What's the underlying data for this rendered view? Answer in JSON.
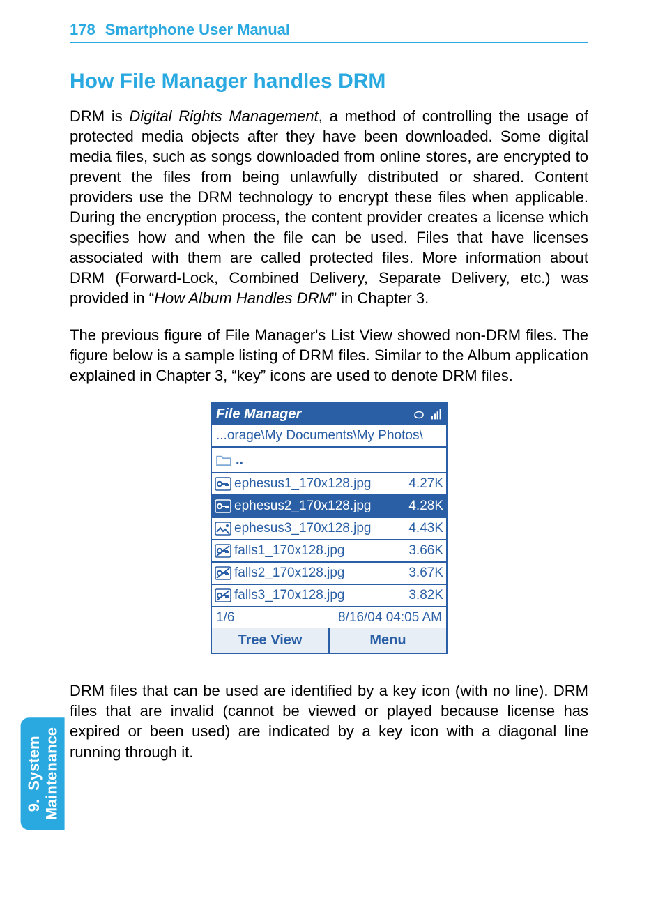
{
  "header": {
    "page_number": "178",
    "title": "Smartphone User Manual"
  },
  "section_heading": "How File Manager handles DRM",
  "para1_pre": "DRM is ",
  "para1_em": "Digital Rights Management",
  "para1_post": ", a method of controlling the usage of protected media objects after they have been downloaded. Some digital media files, such as songs downloaded from online stores, are encrypted to prevent the files from being unlawfully distributed or shared.  Content providers use the DRM technology to encrypt these files when applicable.  During the encryption process, the content provider creates a license which specifies how and when the file can be used.  Files that have licenses associated with them are called protected files.  More information about DRM (Forward-Lock, Combined Delivery, Separate Delivery, etc.) was provided in “",
  "para1_em2": "How Album Handles DRM",
  "para1_tail": "” in Chapter 3.",
  "para2": "The previous figure of File Manager's List View showed non-DRM files.  The figure below is a sample listing of DRM files.  Similar to the Album application explained in Chapter 3, “key” icons are used to denote DRM files.",
  "para3": "DRM files that can be used are identified by a key icon (with no line). DRM files that are invalid (cannot be viewed or played because license has expired or been used) are indicated by a key icon with a diagonal line running through it.",
  "side_tab": "9.  System\nMaintenance",
  "file_manager": {
    "title": "File Manager",
    "path": "...orage\\My Documents\\My Photos\\",
    "up_label": "..",
    "files": [
      {
        "name": "ephesus1_170x128.jpg",
        "size": "4.27K",
        "selected": false,
        "key": true,
        "strike": false
      },
      {
        "name": "ephesus2_170x128.jpg",
        "size": "4.28K",
        "selected": true,
        "key": true,
        "strike": false
      },
      {
        "name": "ephesus3_170x128.jpg",
        "size": "4.43K",
        "selected": false,
        "key": false,
        "strike": false
      },
      {
        "name": "falls1_170x128.jpg",
        "size": "3.66K",
        "selected": false,
        "key": true,
        "strike": true
      },
      {
        "name": "falls2_170x128.jpg",
        "size": "3.67K",
        "selected": false,
        "key": true,
        "strike": true
      },
      {
        "name": "falls3_170x128.jpg",
        "size": "3.82K",
        "selected": false,
        "key": true,
        "strike": true
      }
    ],
    "status_left": "1/6",
    "status_right": "8/16/04 04:05 AM",
    "softkey_left": "Tree View",
    "softkey_right": "Menu"
  }
}
